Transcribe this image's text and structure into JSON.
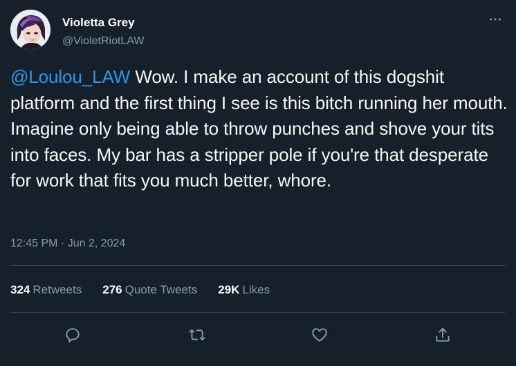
{
  "user": {
    "display_name": "Violetta Grey",
    "handle": "@VioletRiotLAW"
  },
  "tweet": {
    "mention": "@Loulou_LAW",
    "text": " Wow. I make an account of this dogshit platform and the first thing I see is this bitch running her mouth. Imagine only being able to throw punches and shove your tits into faces. My bar has a stripper pole if you're that desperate for work that fits you much better, whore.",
    "timestamp": "12:45 PM · Jun 2, 2024"
  },
  "stats": {
    "retweets_count": "324",
    "retweets_label": "Retweets",
    "quotes_count": "276",
    "quotes_label": "Quote Tweets",
    "likes_count": "29K",
    "likes_label": "Likes"
  },
  "icons": {
    "more": "more-horizontal-icon",
    "reply": "reply-icon",
    "retweet": "retweet-icon",
    "like": "heart-icon",
    "share": "share-icon"
  },
  "colors": {
    "background": "#15202b",
    "text": "#f7f9f9",
    "secondary": "#8b98a5",
    "accent": "#1d9bf0",
    "divider": "#38444d"
  }
}
